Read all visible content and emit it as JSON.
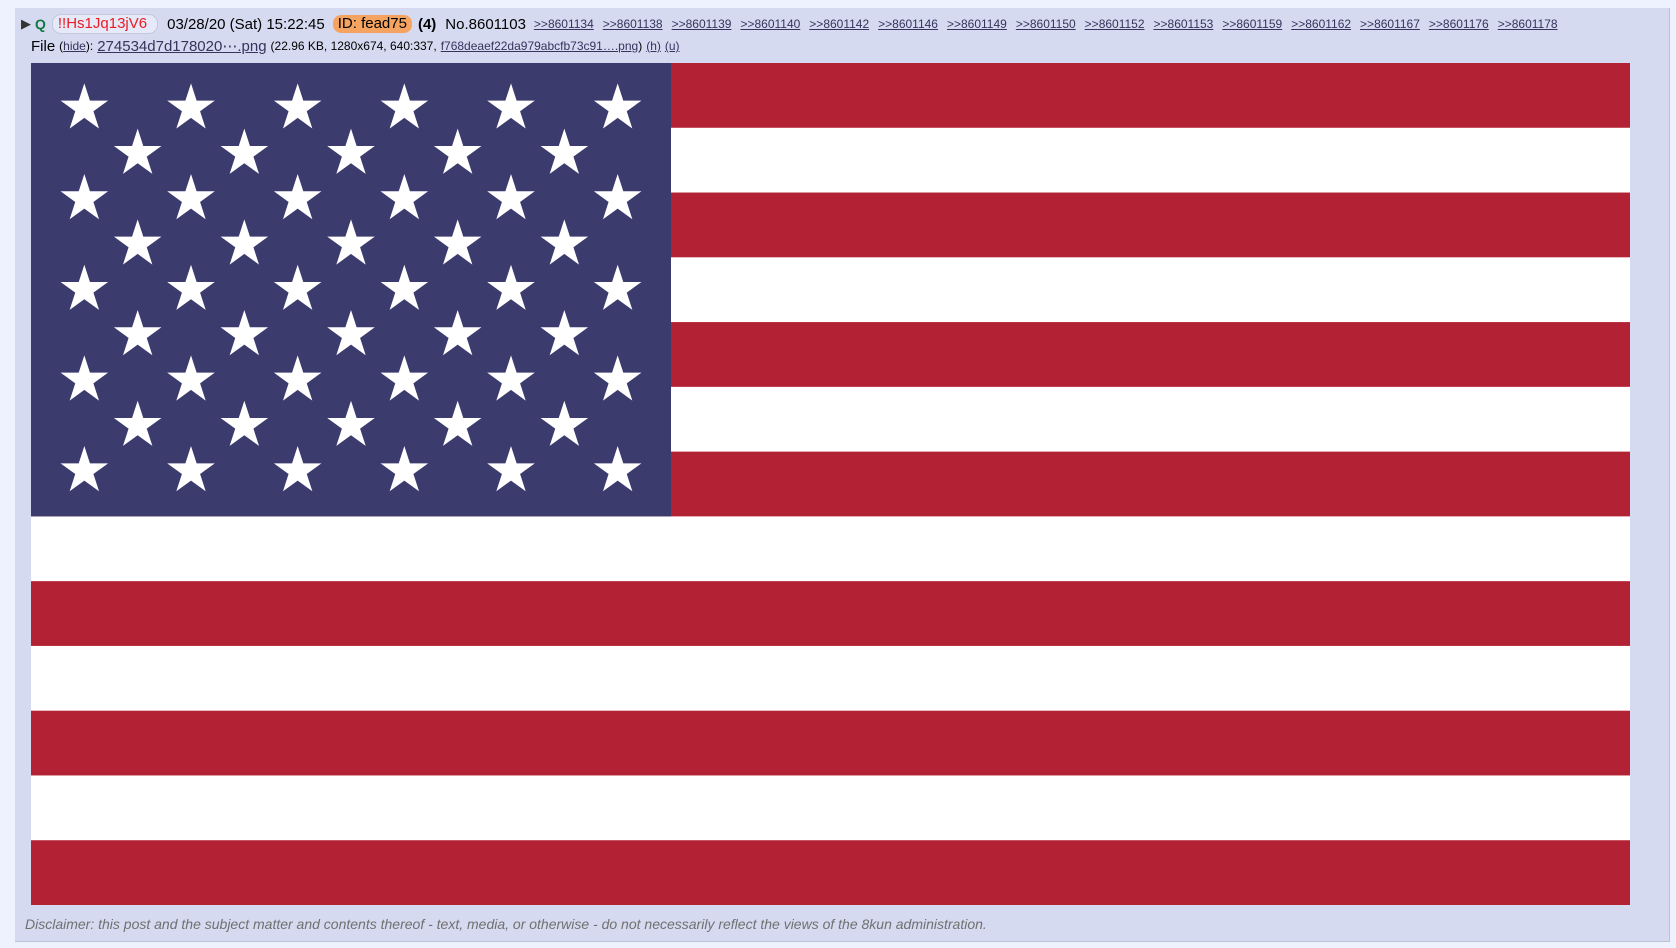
{
  "post": {
    "expand_icon": "▶",
    "name": "Q",
    "tripcode": "!!Hs1Jq13jV6",
    "datetime": "03/28/20 (Sat) 15:22:45",
    "id_label": "ID: fead75",
    "post_count": "(4)",
    "post_number": "No.8601103",
    "backlinks": [
      ">>8601134",
      ">>8601138",
      ">>8601139",
      ">>8601140",
      ">>8601142",
      ">>8601146",
      ">>8601149",
      ">>8601150",
      ">>8601152",
      ">>8601153",
      ">>8601159",
      ">>8601162",
      ">>8601167",
      ">>8601176",
      ">>8601178"
    ]
  },
  "file": {
    "label": "File",
    "hide_open": "(",
    "hide_link": "hide",
    "hide_close": "):",
    "filename": "274534d7d178020⋯.png",
    "meta_open": "(22.96 KB, 1280x674, 640:337,",
    "original_filename": "f768deaef22da979abcfb73c91….png",
    "meta_close": ")",
    "h_link": "(h)",
    "u_link": "(u)"
  },
  "image": {
    "icon": "us-flag",
    "colors": {
      "red": "#b22234",
      "white": "#ffffff",
      "blue": "#3c3b6e"
    }
  },
  "disclaimer": "Disclaimer: this post and the subject matter and contents thereof - text, media, or otherwise - do not necessarily reflect the views of the 8kun administration."
}
